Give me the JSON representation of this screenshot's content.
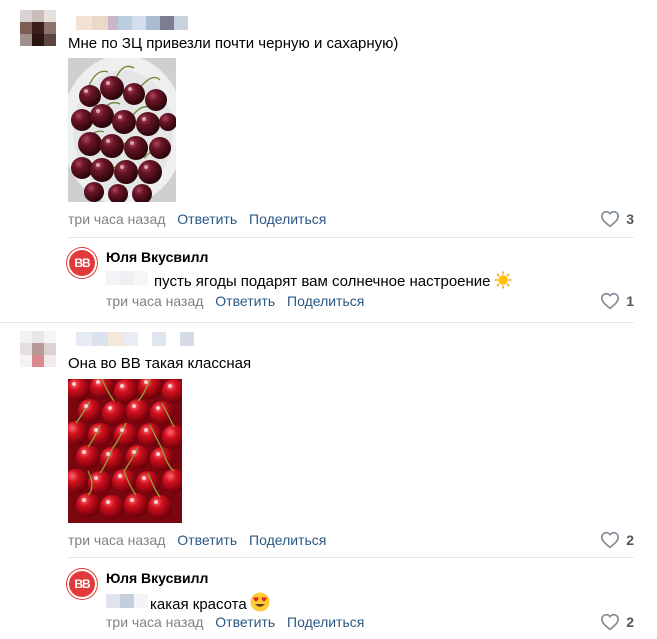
{
  "comments": [
    {
      "text": "Мне по ЗЦ привезли почти черную и сахарную)",
      "time": "три часа назад",
      "reply_label": "Ответить",
      "share_label": "Поделиться",
      "likes": "3",
      "photo": "dark-cherries-photo"
    },
    {
      "text": "Она во ВВ такая классная",
      "time": "три часа назад",
      "reply_label": "Ответить",
      "share_label": "Поделиться",
      "likes": "2",
      "photo": "red-cherries-photo"
    }
  ],
  "replies": [
    {
      "author": "Юля Вкусвилл",
      "logo_text": "ВВ",
      "text": "пусть ягоды подарят вам солнечное настроение",
      "emoji": "sun-emoji",
      "time": "три часа назад",
      "reply_label": "Ответить",
      "share_label": "Поделиться",
      "likes": "1"
    },
    {
      "author": "Юля Вкусвилл",
      "logo_text": "ВВ",
      "text": "какая красота",
      "emoji": "heart-eyes-emoji",
      "time": "три часа назад",
      "reply_label": "Ответить",
      "share_label": "Поделиться",
      "likes": "2"
    }
  ],
  "colors": {
    "link": "#2a5885",
    "meta": "#828282",
    "brand": "#e23a3a"
  }
}
